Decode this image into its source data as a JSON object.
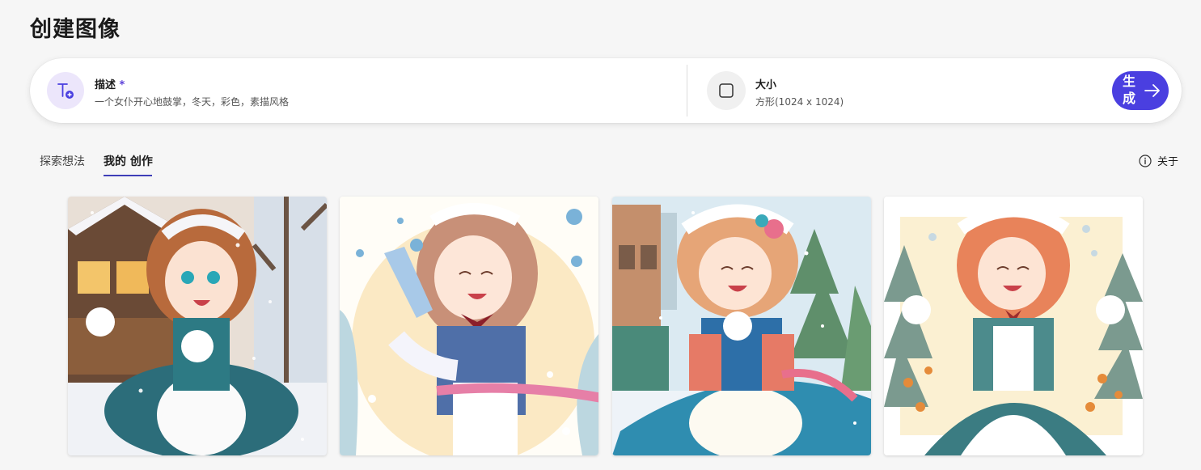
{
  "page": {
    "title": "创建图像"
  },
  "prompt": {
    "description_label": "描述",
    "required_mark": "*",
    "description_value": "一个女仆开心地鼓掌，冬天，彩色，素描风格",
    "size_label": "大小",
    "size_value": "方形(1024 x 1024)",
    "generate_label": "生成"
  },
  "tabs": [
    {
      "label": "探索想法",
      "active": false
    },
    {
      "label": "我的 创作",
      "active": true
    }
  ],
  "about": {
    "label": "关于"
  },
  "colors": {
    "accent": "#4a3fe0",
    "tab_underline": "#3f3fb8",
    "icon_bg": "#ece6fb"
  },
  "images": [
    {
      "name": "maid-winter-house"
    },
    {
      "name": "maid-snowflakes-blue-dress"
    },
    {
      "name": "maid-city-snow"
    },
    {
      "name": "maid-snowy-forest"
    }
  ]
}
